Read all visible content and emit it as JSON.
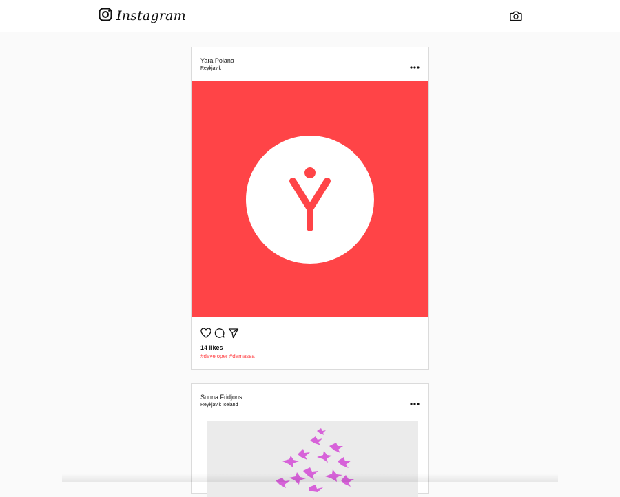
{
  "header": {
    "app_name": "Instagram",
    "logo_icon": "instagram-logo-icon",
    "camera_icon": "camera-icon"
  },
  "posts": [
    {
      "username": "Yara Polana",
      "location": "Reykjavik",
      "image_icon": "damassa-logo",
      "image_bg": "#ff4447",
      "likes": "14 likes",
      "tags": "#developer #damassa"
    },
    {
      "username": "Sunna Fridjons",
      "location": "Reykjavik Iceland",
      "image_icon": "birds-illustration"
    }
  ],
  "icons": {
    "more": "more-horizontal-icon",
    "like": "heart-icon",
    "comment": "comment-icon",
    "share": "send-icon"
  },
  "colors": {
    "accent": "#ff4447",
    "birds": "#d44bd6"
  }
}
